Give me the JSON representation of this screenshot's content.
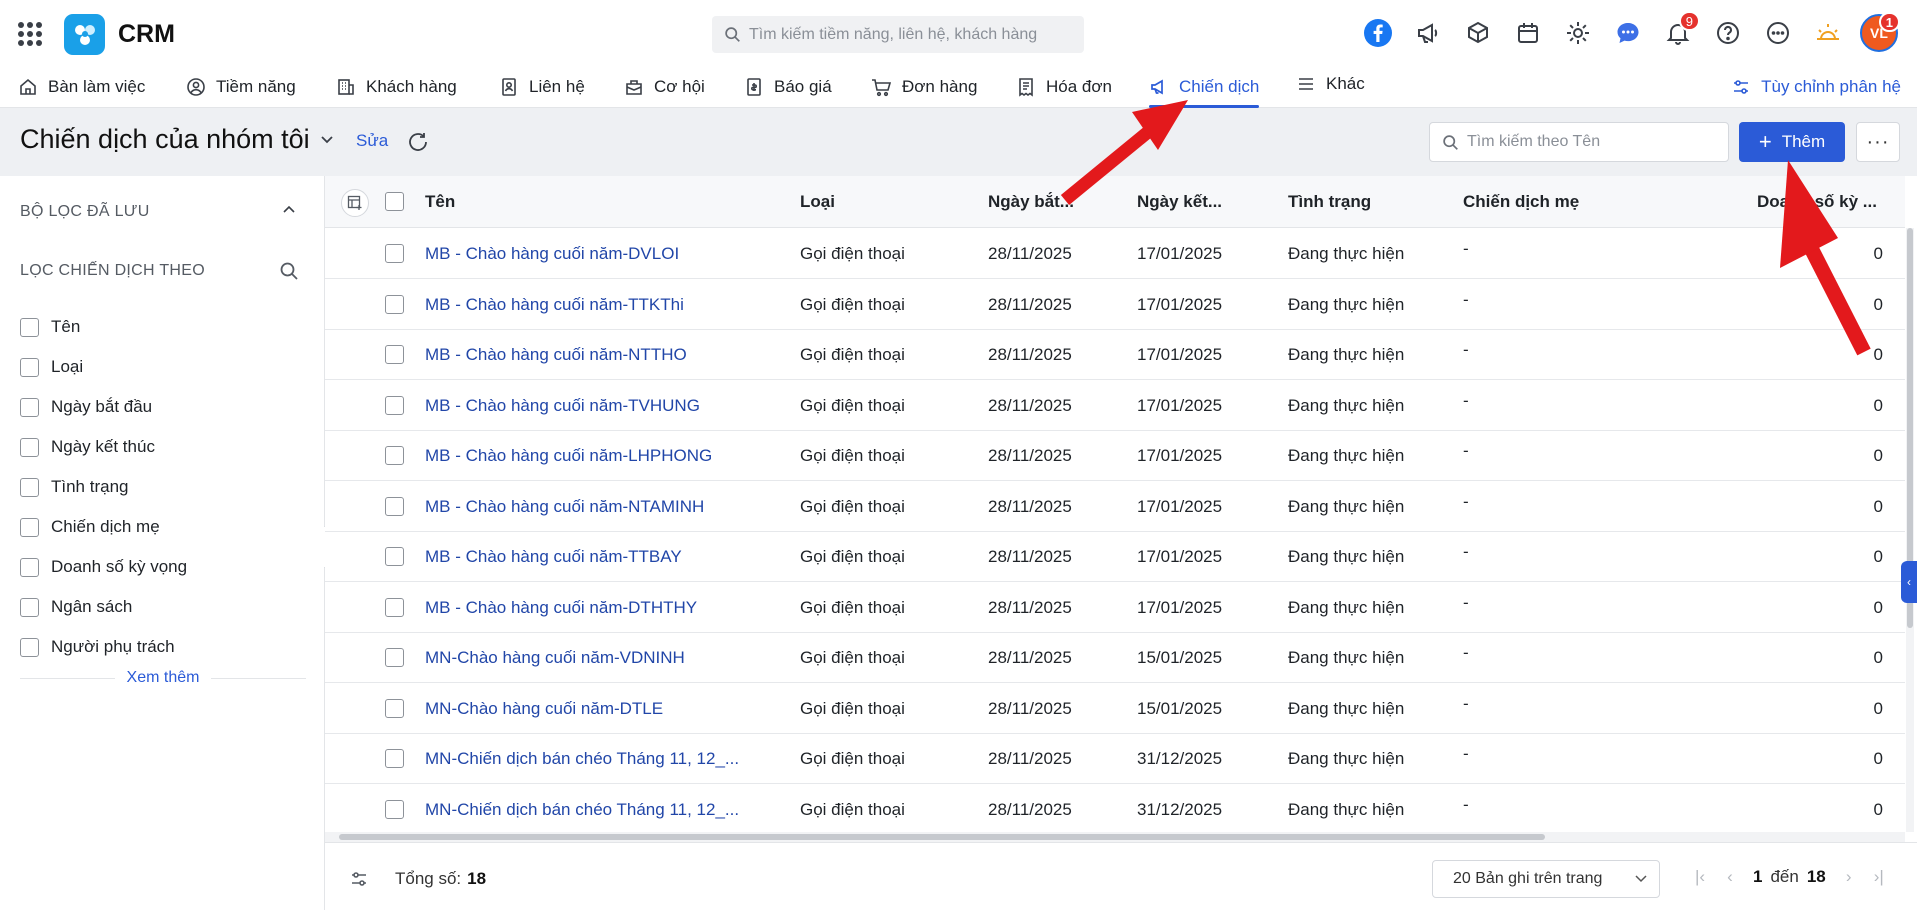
{
  "header": {
    "app_title": "CRM",
    "search_placeholder": "Tìm kiếm tiềm năng, liên hệ, khách hàng",
    "notification_count": "9",
    "avatar_initials": "VL",
    "avatar_badge": "1"
  },
  "nav": {
    "items": [
      {
        "label": "Bàn làm việc",
        "icon": "home-icon"
      },
      {
        "label": "Tiềm năng",
        "icon": "user-circle-icon"
      },
      {
        "label": "Khách hàng",
        "icon": "building-icon"
      },
      {
        "label": "Liên hệ",
        "icon": "contact-card-icon"
      },
      {
        "label": "Cơ hội",
        "icon": "briefcase-icon"
      },
      {
        "label": "Báo giá",
        "icon": "quote-doc-icon"
      },
      {
        "label": "Đơn hàng",
        "icon": "cart-icon"
      },
      {
        "label": "Hóa đơn",
        "icon": "invoice-icon"
      },
      {
        "label": "Chiến dịch",
        "icon": "megaphone-icon",
        "active": true
      },
      {
        "label": "Khác",
        "icon": "menu-lines-icon"
      }
    ],
    "customize_label": "Tùy chỉnh phân hệ"
  },
  "page": {
    "title": "Chiến dịch của nhóm tôi",
    "edit_label": "Sửa",
    "name_search_placeholder": "Tìm kiếm theo Tên",
    "add_label": "Thêm",
    "more_label": "···"
  },
  "sidebar": {
    "saved_filters_title": "BỘ LỌC ĐÃ LƯU",
    "filter_by_title": "LỌC CHIẾN DỊCH THEO",
    "filters": [
      "Tên",
      "Loại",
      "Ngày bắt đầu",
      "Ngày kết thúc",
      "Tình trạng",
      "Chiến dịch mẹ",
      "Doanh số kỳ vọng",
      "Ngân sách",
      "Người phụ trách"
    ],
    "see_more": "Xem thêm"
  },
  "table": {
    "columns": [
      "Tên",
      "Loại",
      "Ngày bắt...",
      "Ngày kết...",
      "Tình trạng",
      "Chiến dịch mẹ",
      "Doanh số kỳ ..."
    ],
    "rows": [
      {
        "name": "MB - Chào hàng cuối năm-DVLOI",
        "type": "Gọi điện thoại",
        "start": "28/11/2025",
        "end": "17/01/2025",
        "status": "Đang thực hiện",
        "parent": "-",
        "revenue": "0"
      },
      {
        "name": "MB - Chào hàng cuối năm-TTKThi",
        "type": "Gọi điện thoại",
        "start": "28/11/2025",
        "end": "17/01/2025",
        "status": "Đang thực hiện",
        "parent": "-",
        "revenue": "0"
      },
      {
        "name": "MB - Chào hàng cuối năm-NTTHO",
        "type": "Gọi điện thoại",
        "start": "28/11/2025",
        "end": "17/01/2025",
        "status": "Đang thực hiện",
        "parent": "-",
        "revenue": "0"
      },
      {
        "name": "MB - Chào hàng cuối năm-TVHUNG",
        "type": "Gọi điện thoại",
        "start": "28/11/2025",
        "end": "17/01/2025",
        "status": "Đang thực hiện",
        "parent": "-",
        "revenue": "0"
      },
      {
        "name": "MB - Chào hàng cuối năm-LHPHONG",
        "type": "Gọi điện thoại",
        "start": "28/11/2025",
        "end": "17/01/2025",
        "status": "Đang thực hiện",
        "parent": "-",
        "revenue": "0"
      },
      {
        "name": "MB - Chào hàng cuối năm-NTAMINH",
        "type": "Gọi điện thoại",
        "start": "28/11/2025",
        "end": "17/01/2025",
        "status": "Đang thực hiện",
        "parent": "-",
        "revenue": "0"
      },
      {
        "name": "MB - Chào hàng cuối năm-TTBAY",
        "type": "Gọi điện thoại",
        "start": "28/11/2025",
        "end": "17/01/2025",
        "status": "Đang thực hiện",
        "parent": "-",
        "revenue": "0"
      },
      {
        "name": "MB - Chào hàng cuối năm-DTHTHY",
        "type": "Gọi điện thoại",
        "start": "28/11/2025",
        "end": "17/01/2025",
        "status": "Đang thực hiện",
        "parent": "-",
        "revenue": "0"
      },
      {
        "name": "MN-Chào hàng cuối năm-VDNINH",
        "type": "Gọi điện thoại",
        "start": "28/11/2025",
        "end": "15/01/2025",
        "status": "Đang thực hiện",
        "parent": "-",
        "revenue": "0"
      },
      {
        "name": "MN-Chào hàng cuối năm-DTLE",
        "type": "Gọi điện thoại",
        "start": "28/11/2025",
        "end": "15/01/2025",
        "status": "Đang thực hiện",
        "parent": "-",
        "revenue": "0"
      },
      {
        "name": "MN-Chiến dịch bán chéo Tháng 11, 12_...",
        "type": "Gọi điện thoại",
        "start": "28/11/2025",
        "end": "31/12/2025",
        "status": "Đang thực hiện",
        "parent": "-",
        "revenue": "0"
      },
      {
        "name": "MN-Chiến dịch bán chéo Tháng 11, 12_...",
        "type": "Gọi điện thoại",
        "start": "28/11/2025",
        "end": "31/12/2025",
        "status": "Đang thực hiện",
        "parent": "-",
        "revenue": "0"
      }
    ]
  },
  "footer": {
    "total_label": "Tổng số:",
    "total_value": "18",
    "per_page": "20 Bản ghi trên trang",
    "current_page": "1",
    "to_label": "đến",
    "last_page": "18"
  },
  "colors": {
    "accent": "#2b5bd7",
    "link": "#2146a8",
    "annotation_arrow": "#e3191c"
  }
}
